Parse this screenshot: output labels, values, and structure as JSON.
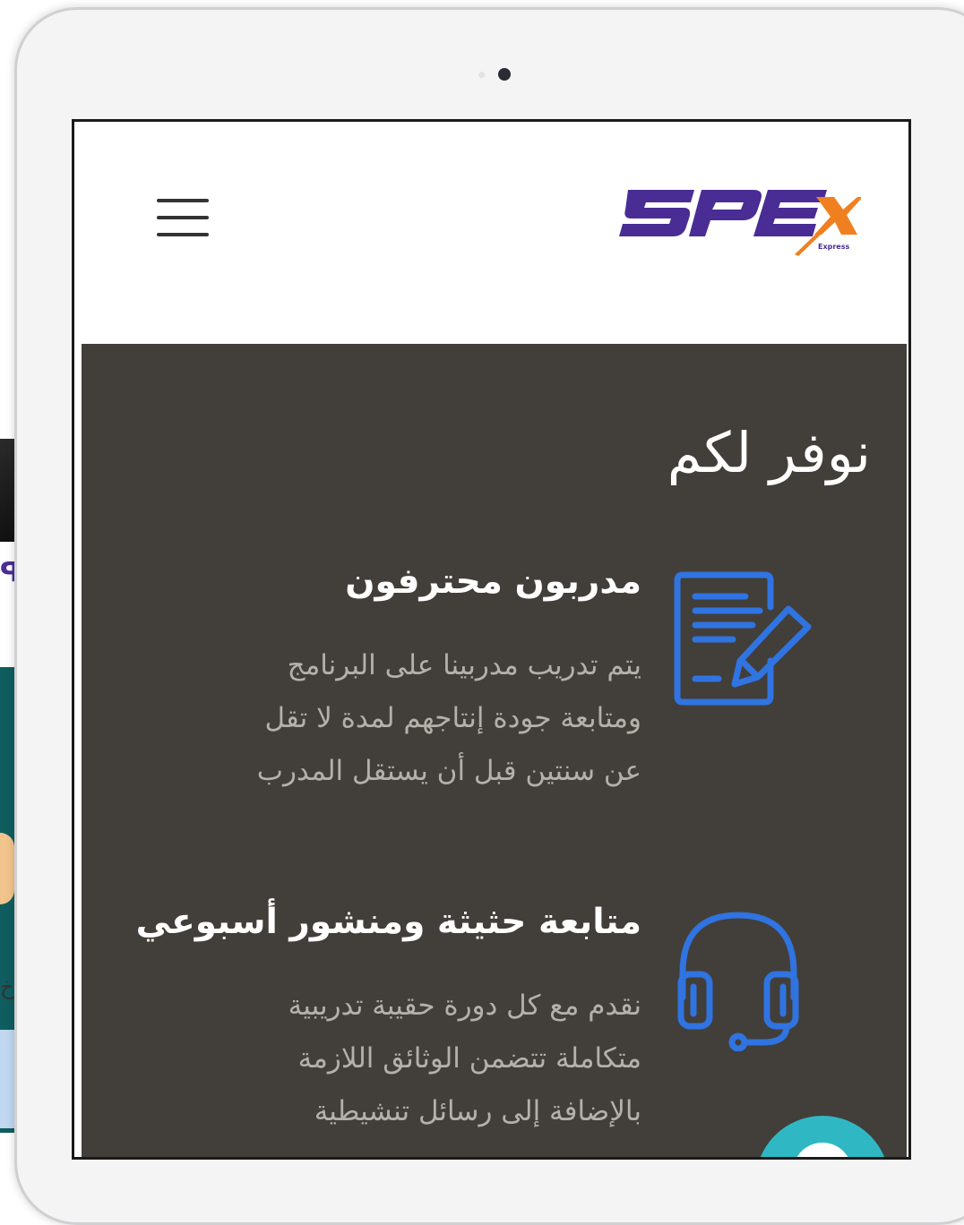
{
  "page": {
    "logo_text": "SPEx",
    "logo_subtext": "Express"
  },
  "section": {
    "title": "نوفر لكم"
  },
  "features": [
    {
      "title": "مدربون محترفون",
      "lines": [
        "يتم تدريب مدربينا على البرنامج",
        "ومتابعة جودة إنتاجهم لمدة لا تقل",
        "عن سنتين قبل أن يستقل المدرب"
      ],
      "icon": "document-edit-icon"
    },
    {
      "title": "متابعة حثيثة ومنشور أسبوعي",
      "lines": [
        "نقدم مع كل دورة حقيبة تدريبية",
        "متكاملة تتضمن الوثائق اللازمة",
        "بالإضافة إلى رسائل تنشيطية"
      ],
      "icon": "headset-icon"
    }
  ],
  "colors": {
    "section_bg": "#423e3a",
    "icon_blue": "#2f74e0",
    "logo_purple": "#4a2c95",
    "logo_orange": "#f0801f",
    "chat_teal": "#2fb8c4"
  }
}
